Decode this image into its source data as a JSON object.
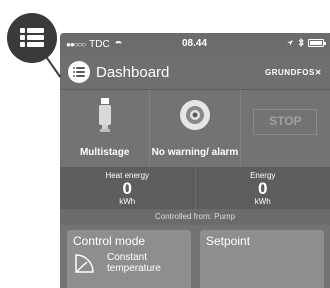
{
  "status_bar": {
    "carrier": "TDC",
    "signal": "●●○○○",
    "time": "08.44",
    "icons": [
      "wifi-icon",
      "location-icon",
      "bluetooth-icon",
      "battery-icon"
    ]
  },
  "header": {
    "title": "Dashboard",
    "brand": "GRUNDFOS",
    "menu_icon": "menu-list-icon"
  },
  "tiles": [
    {
      "label": "Multistage",
      "icon": "pump-icon"
    },
    {
      "label": "No warning/ alarm",
      "icon": "warning-indicator-icon"
    },
    {
      "label": "STOP"
    }
  ],
  "energy": {
    "heat": {
      "label": "Heat energy",
      "value": "0",
      "unit": "kWh"
    },
    "total": {
      "label": "Energy",
      "value": "0",
      "unit": "kWh"
    }
  },
  "controlled_from": "Controlled from: Pump",
  "cards": {
    "control_mode": {
      "title": "Control mode",
      "value": "Constant temperature"
    },
    "setpoint": {
      "title": "Setpoint"
    }
  },
  "colors": {
    "panel": "#737373",
    "callout": "#3a3a3a",
    "card": "#8e8e8e"
  }
}
